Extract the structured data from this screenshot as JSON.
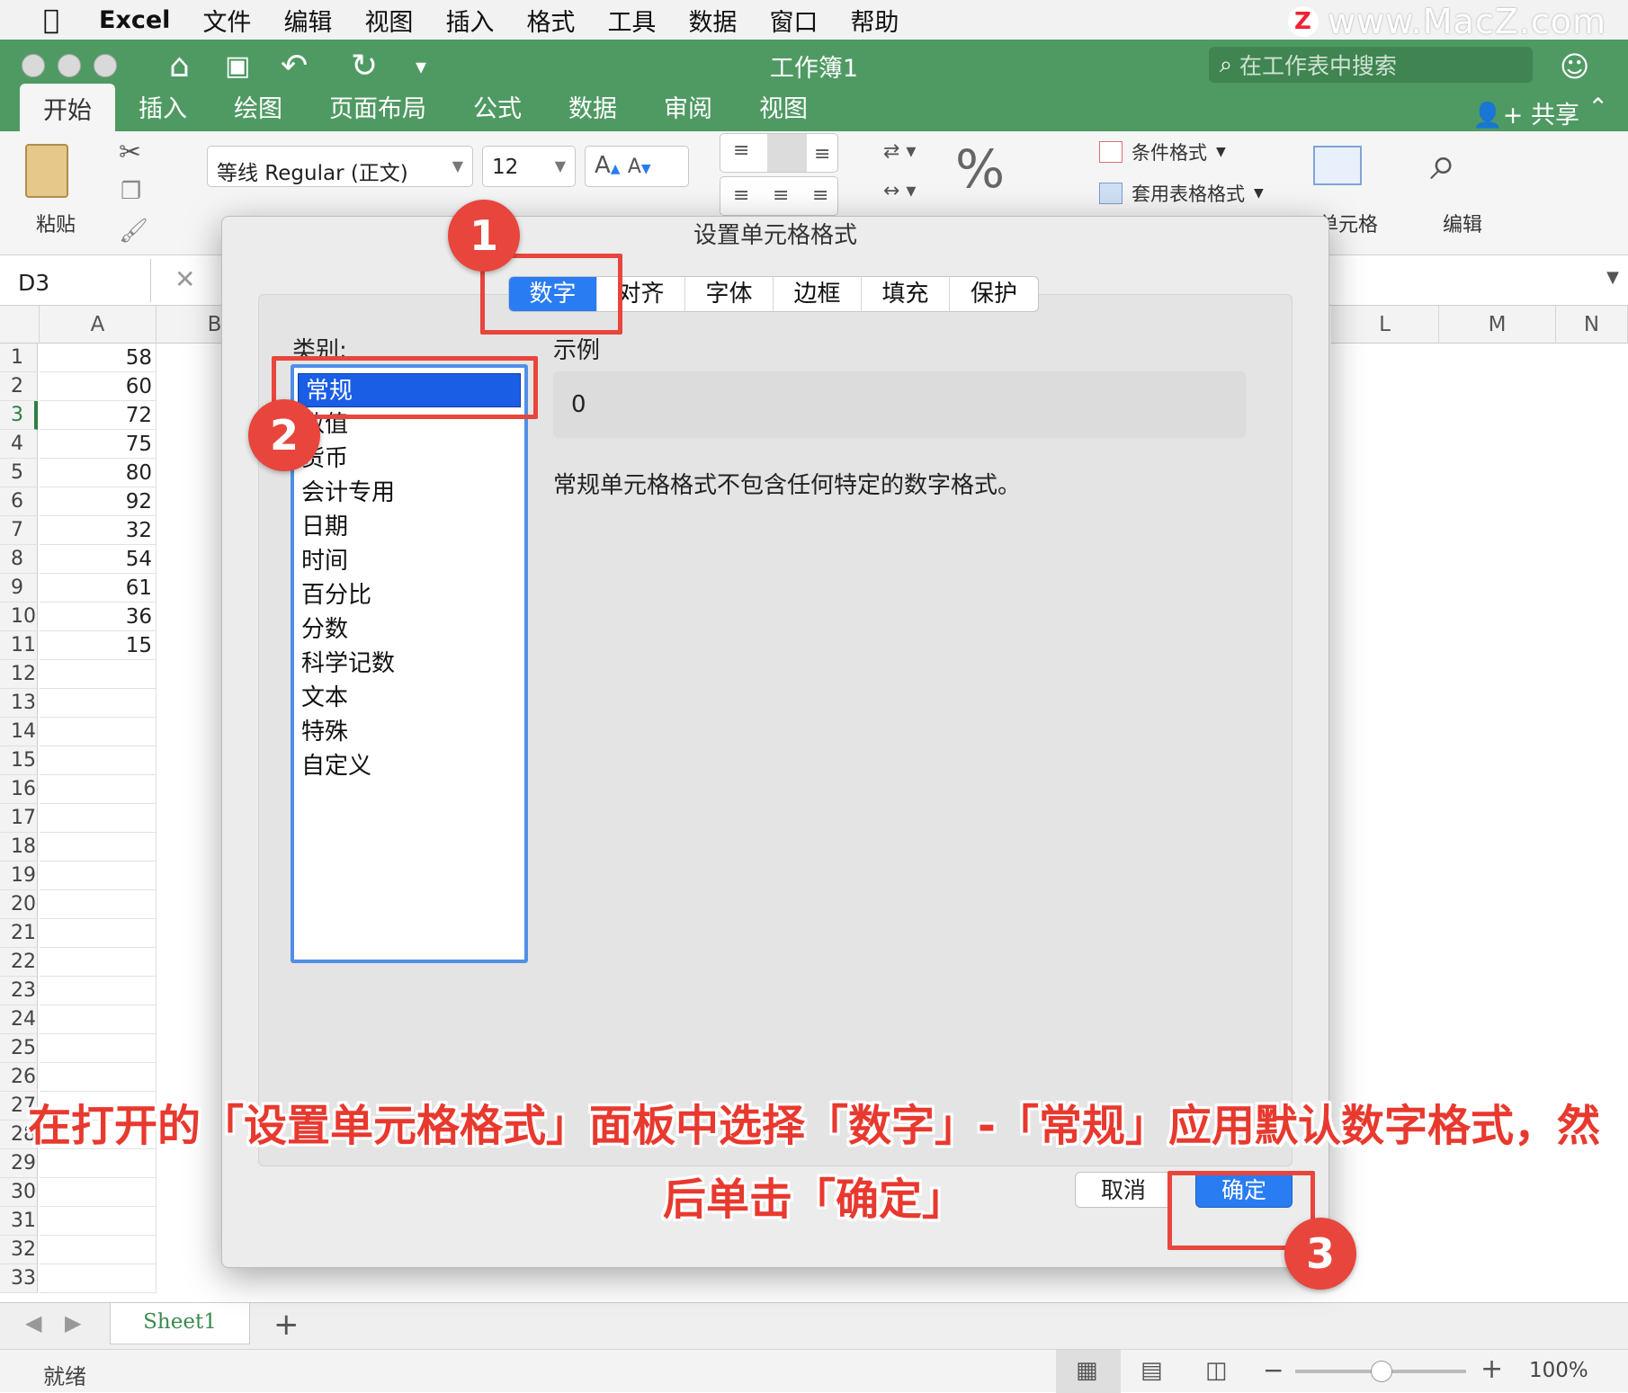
{
  "menubar": {
    "items": [
      "Excel",
      "文件",
      "编辑",
      "视图",
      "插入",
      "格式",
      "工具",
      "数据",
      "窗口",
      "帮助"
    ]
  },
  "watermark": "www.MacZ.com",
  "titlebar": {
    "title": "工作簿1",
    "search_placeholder": "在工作表中搜索"
  },
  "ribbon_tabs": [
    "开始",
    "插入",
    "绘图",
    "页面布局",
    "公式",
    "数据",
    "审阅",
    "视图"
  ],
  "share_label": "共享",
  "ribbon": {
    "paste_label": "粘贴",
    "font_name": "等线 Regular (正文)",
    "font_size": "12",
    "grow_font": "A",
    "shrink_font": "A",
    "percent_symbol": "%",
    "cond_format": "条件格式",
    "table_format": "套用表格格式",
    "cells_label": "单元格",
    "edit_label": "编辑"
  },
  "formula_bar": {
    "name_box": "D3",
    "cancel_symbol": "✕"
  },
  "grid": {
    "columns_left": [
      "A",
      "B"
    ],
    "columns_right": [
      "L",
      "M",
      "N"
    ],
    "row_numbers": [
      "1",
      "2",
      "3",
      "4",
      "5",
      "6",
      "7",
      "8",
      "9",
      "10",
      "11",
      "12",
      "13",
      "14",
      "15",
      "16",
      "17",
      "18",
      "19",
      "20",
      "21",
      "22",
      "23",
      "24",
      "25",
      "26",
      "27",
      "28",
      "29",
      "30",
      "31",
      "32",
      "33"
    ],
    "col_a_values": [
      "58",
      "60",
      "72",
      "75",
      "80",
      "92",
      "32",
      "54",
      "61",
      "36",
      "15"
    ]
  },
  "sheet_tab": "Sheet1",
  "add_sheet": "+",
  "status": {
    "ready": "就绪",
    "zoom": "100%"
  },
  "dialog": {
    "title": "设置单元格格式",
    "tabs": [
      "数字",
      "对齐",
      "字体",
      "边框",
      "填充",
      "保护"
    ],
    "category_label": "类别:",
    "categories": [
      "常规",
      "数值",
      "货币",
      "会计专用",
      "日期",
      "时间",
      "百分比",
      "分数",
      "科学记数",
      "文本",
      "特殊",
      "自定义"
    ],
    "sample_label": "示例",
    "sample_value": "0",
    "description": "常规单元格格式不包含任何特定的数字格式。",
    "cancel": "取消",
    "ok": "确定"
  },
  "annotations": {
    "badge1": "1",
    "badge2": "2",
    "badge3": "3",
    "caption_line1": "在打开的「设置单元格格式」面板中选择「数字」-「常规」应用默认数字格式，然",
    "caption_line2": "后单击「确定」"
  },
  "colors": {
    "excel_green": "#4f9a63",
    "accent_blue": "#2a7cf2",
    "annotation_red": "#e8453c"
  }
}
